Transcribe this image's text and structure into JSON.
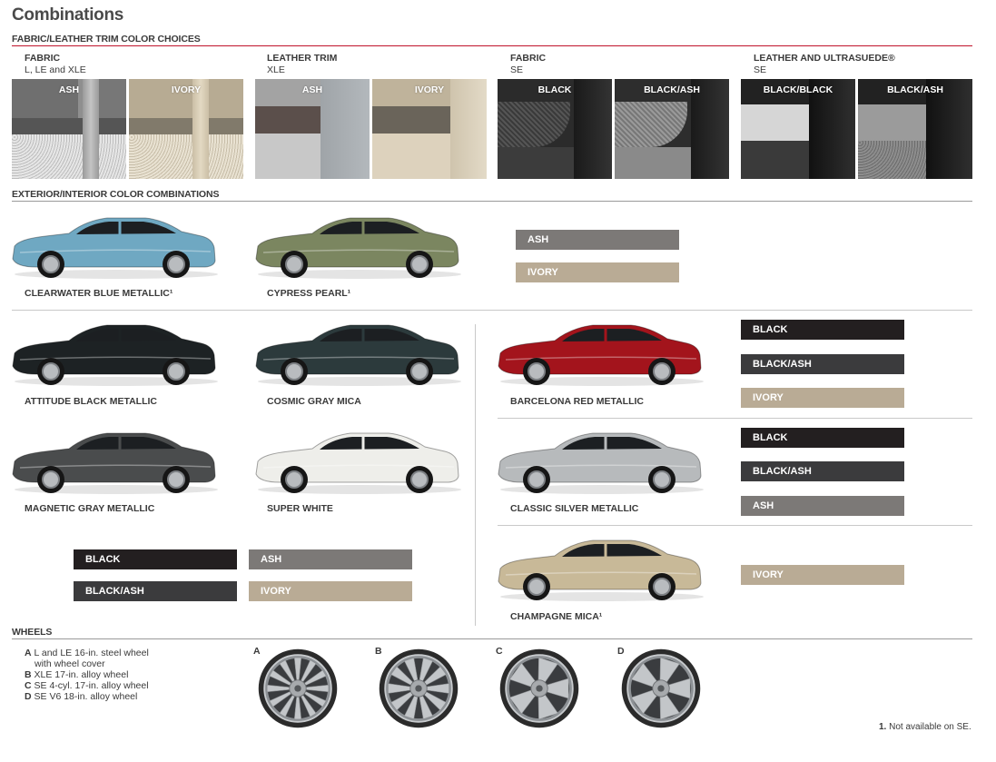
{
  "title": "Combinations",
  "trim_section": {
    "heading": "FABRIC/LEATHER TRIM COLOR CHOICES",
    "groups": [
      {
        "name": "FABRIC",
        "models": "L, LE and XLE",
        "swatches": [
          "ASH",
          "IVORY"
        ]
      },
      {
        "name": "LEATHER TRIM",
        "models": "XLE",
        "swatches": [
          "ASH",
          "IVORY"
        ]
      },
      {
        "name": "FABRIC",
        "models": "SE",
        "swatches": [
          "BLACK",
          "BLACK/ASH"
        ]
      },
      {
        "name": "LEATHER AND ULTRASUEDE®",
        "models": "SE",
        "swatches": [
          "BLACK/BLACK",
          "BLACK/ASH"
        ]
      }
    ]
  },
  "combo_section": {
    "heading": "EXTERIOR/INTERIOR COLOR COMBINATIONS",
    "cars": [
      {
        "name": "CLEARWATER BLUE METALLIC¹",
        "color": "#6fa8c2"
      },
      {
        "name": "CYPRESS PEARL¹",
        "color": "#7b8660"
      },
      {
        "name": "ATTITUDE BLACK METALLIC",
        "color": "#1d2224"
      },
      {
        "name": "COSMIC GRAY MICA",
        "color": "#2c3a3c"
      },
      {
        "name": "BARCELONA RED METALLIC",
        "color": "#a3141c"
      },
      {
        "name": "MAGNETIC GRAY METALLIC",
        "color": "#4a4c4d"
      },
      {
        "name": "SUPER WHITE",
        "color": "#eeeeea"
      },
      {
        "name": "CLASSIC SILVER METALLIC",
        "color": "#b7babc"
      },
      {
        "name": "CHAMPAGNE MICA¹",
        "color": "#c8b998"
      }
    ],
    "tags": {
      "ash": "ASH",
      "ivory": "IVORY",
      "black": "BLACK",
      "black_ash": "BLACK/ASH"
    },
    "tag_colors": {
      "black": "#231f20",
      "black_ash": "#3b3b3d",
      "ash": "#7c7977",
      "ivory": "#b9ab95"
    }
  },
  "wheels_section": {
    "heading": "WHEELS",
    "list": [
      {
        "letter": "A",
        "text": "L and LE 16-in. steel wheel",
        "text2": "with wheel cover"
      },
      {
        "letter": "B",
        "text": "XLE 17-in. alloy wheel"
      },
      {
        "letter": "C",
        "text": "SE 4-cyl. 17-in. alloy wheel"
      },
      {
        "letter": "D",
        "text": "SE V6 18-in. alloy wheel"
      }
    ],
    "images": [
      "A",
      "B",
      "C",
      "D"
    ]
  },
  "footnote": {
    "num": "1.",
    "text": "Not available on SE."
  },
  "colors": {
    "accent_red": "#c0142b"
  }
}
